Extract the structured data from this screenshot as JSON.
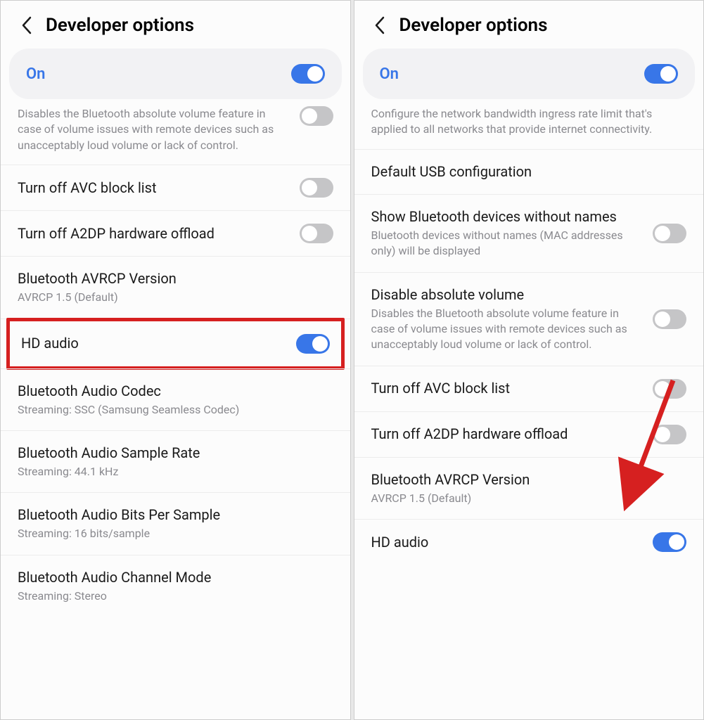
{
  "left": {
    "header": {
      "title": "Developer options"
    },
    "on_bar": {
      "label": "On",
      "toggled": true
    },
    "partial": {
      "sub": "Disables the Bluetooth absolute volume feature in case of volume issues with remote devices such as unacceptably loud volume or lack of control.",
      "toggle": "off"
    },
    "items": [
      {
        "label": "Turn off AVC block list",
        "toggle": "off"
      },
      {
        "label": "Turn off A2DP hardware offload",
        "toggle": "off"
      },
      {
        "label": "Bluetooth AVRCP Version",
        "sub": "AVRCP 1.5 (Default)"
      },
      {
        "label": "HD audio",
        "toggle": "on",
        "highlight": true
      },
      {
        "label": "Bluetooth Audio Codec",
        "sub": "Streaming: SSC (Samsung Seamless Codec)"
      },
      {
        "label": "Bluetooth Audio Sample Rate",
        "sub": "Streaming: 44.1 kHz"
      },
      {
        "label": "Bluetooth Audio Bits Per Sample",
        "sub": "Streaming: 16 bits/sample"
      },
      {
        "label": "Bluetooth Audio Channel Mode",
        "sub": "Streaming: Stereo"
      }
    ]
  },
  "right": {
    "header": {
      "title": "Developer options"
    },
    "on_bar": {
      "label": "On",
      "toggled": true
    },
    "partial": {
      "sub": "Configure the network bandwidth ingress rate limit that's applied to all networks that provide internet connectivity."
    },
    "items": [
      {
        "label": "Default USB configuration"
      },
      {
        "label": "Show Bluetooth devices without names",
        "sub": "Bluetooth devices without names (MAC addresses only) will be displayed",
        "toggle": "off"
      },
      {
        "label": "Disable absolute volume",
        "sub": "Disables the Bluetooth absolute volume feature in case of volume issues with remote devices such as unacceptably loud volume or lack of control.",
        "toggle": "off",
        "arrow": true
      },
      {
        "label": "Turn off AVC block list",
        "toggle": "off"
      },
      {
        "label": "Turn off A2DP hardware offload",
        "toggle": "off"
      },
      {
        "label": "Bluetooth AVRCP Version",
        "sub": "AVRCP 1.5 (Default)"
      },
      {
        "label": "HD audio",
        "toggle": "on"
      }
    ]
  }
}
